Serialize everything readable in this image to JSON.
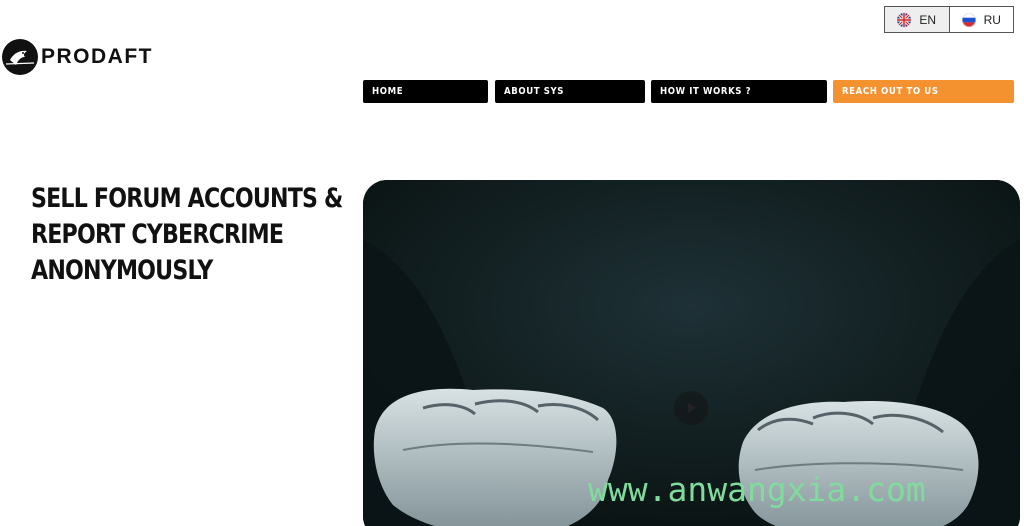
{
  "language_switcher": {
    "options": [
      {
        "code": "EN",
        "flag": "uk-flag-icon",
        "selected": true
      },
      {
        "code": "RU",
        "flag": "russia-flag-icon",
        "selected": false
      }
    ]
  },
  "logo": {
    "text": "PRODAFT",
    "icon": "crow-logo-icon"
  },
  "nav": {
    "home": "HOME",
    "about": "ABOUT SYS",
    "how": "HOW IT WORKS ?",
    "reach": "REACH OUT TO US"
  },
  "hero": {
    "title_lines": [
      "SELL FORUM ACCOUNTS &",
      "REPORT CYBERCRIME",
      "ANONYMOUSLY"
    ]
  },
  "video": {
    "play_icon": "play-icon"
  },
  "watermark": {
    "text": "www.anwangxia.com"
  },
  "colors": {
    "accent": "#f4922f",
    "nav_bg": "#000000",
    "video_bg": "#0e1b1f",
    "watermark": "#7fdc9c"
  }
}
